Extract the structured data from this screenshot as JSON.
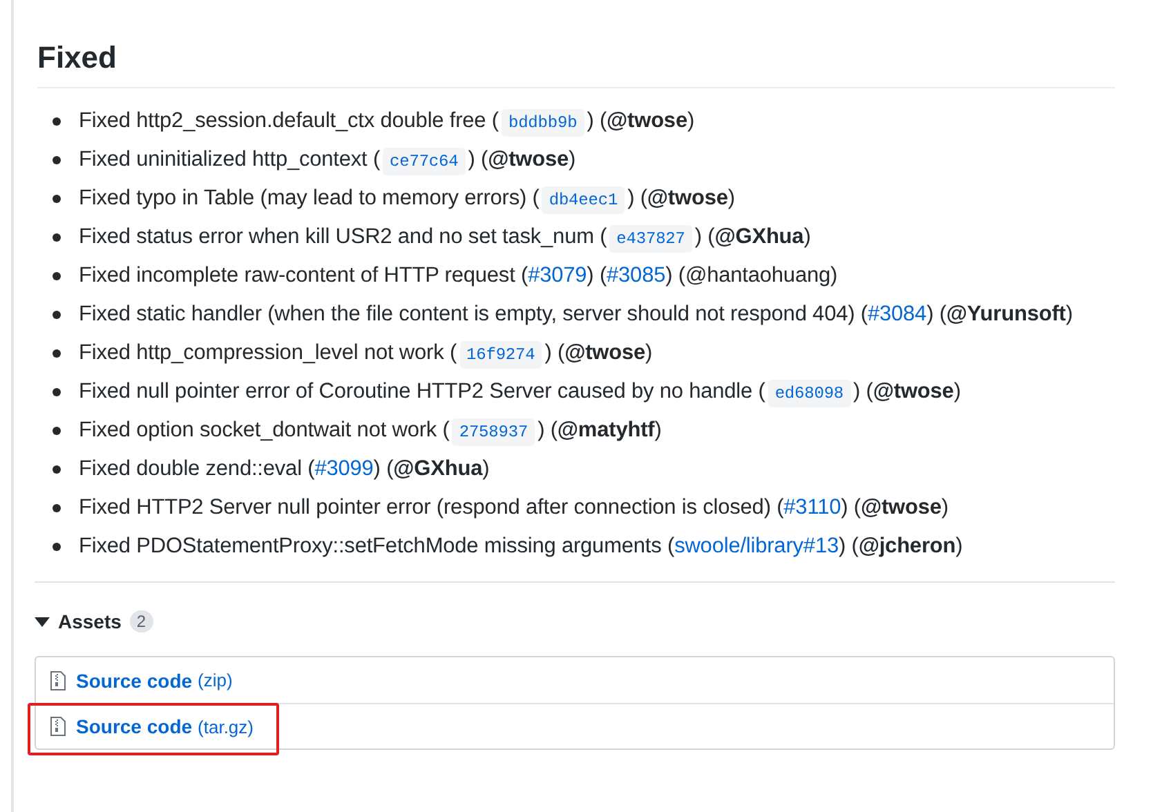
{
  "section": {
    "title": "Fixed",
    "items": [
      [
        {
          "kind": "text",
          "text": "Fixed http2_session.default_ctx double free ("
        },
        {
          "kind": "code",
          "text": "bddbb9b"
        },
        {
          "kind": "text",
          "text": ") (**@twose**)"
        }
      ],
      [
        {
          "kind": "text",
          "text": "Fixed uninitialized http_context ("
        },
        {
          "kind": "code",
          "text": "ce77c64"
        },
        {
          "kind": "text",
          "text": ") (**@twose**)"
        }
      ],
      [
        {
          "kind": "text",
          "text": "Fixed typo in Table (may lead to memory errors) ("
        },
        {
          "kind": "code",
          "text": "db4eec1"
        },
        {
          "kind": "text",
          "text": ") (**@twose**)"
        }
      ],
      [
        {
          "kind": "text",
          "text": "Fixed status error when kill USR2 and no set task_num ("
        },
        {
          "kind": "code",
          "text": "e437827"
        },
        {
          "kind": "text",
          "text": ") (**@GXhua**)"
        }
      ],
      [
        {
          "kind": "text",
          "text": "Fixed incomplete raw-content of HTTP request ("
        },
        {
          "kind": "link",
          "text": "#3079"
        },
        {
          "kind": "text",
          "text": ") ("
        },
        {
          "kind": "link",
          "text": "#3085"
        },
        {
          "kind": "text",
          "text": ") (@hantaohuang)"
        }
      ],
      [
        {
          "kind": "text",
          "text": "Fixed static handler (when the file content is empty, server should not respond 404) ("
        },
        {
          "kind": "link",
          "text": "#3084"
        },
        {
          "kind": "text",
          "text": ") (**@Yurunsoft**)"
        }
      ],
      [
        {
          "kind": "text",
          "text": "Fixed http_compression_level not work ("
        },
        {
          "kind": "code",
          "text": "16f9274"
        },
        {
          "kind": "text",
          "text": ") (**@twose**)"
        }
      ],
      [
        {
          "kind": "text",
          "text": "Fixed null pointer error of Coroutine HTTP2 Server caused by no handle ("
        },
        {
          "kind": "code",
          "text": "ed68098"
        },
        {
          "kind": "text",
          "text": ") (**@twose**)"
        }
      ],
      [
        {
          "kind": "text",
          "text": "Fixed option socket_dontwait not work ("
        },
        {
          "kind": "code",
          "text": "2758937"
        },
        {
          "kind": "text",
          "text": ") (**@matyhtf**)"
        }
      ],
      [
        {
          "kind": "text",
          "text": "Fixed double zend::eval ("
        },
        {
          "kind": "link",
          "text": "#3099"
        },
        {
          "kind": "text",
          "text": ") (**@GXhua**)"
        }
      ],
      [
        {
          "kind": "text",
          "text": "Fixed HTTP2 Server null pointer error (respond after connection is closed) ("
        },
        {
          "kind": "link",
          "text": "#3110"
        },
        {
          "kind": "text",
          "text": ") (**@twose**)"
        }
      ],
      [
        {
          "kind": "text",
          "text": "Fixed PDOStatementProxy::setFetchMode missing arguments ("
        },
        {
          "kind": "link",
          "text": "swoole/library#13"
        },
        {
          "kind": "text",
          "text": ") (**@jcheron**)"
        }
      ]
    ]
  },
  "assets": {
    "title": "Assets",
    "count": "2",
    "expanded": true,
    "items": [
      {
        "name": "Source code",
        "format": "(zip)",
        "highlighted": false
      },
      {
        "name": "Source code",
        "format": "(tar.gz)",
        "highlighted": true
      }
    ]
  }
}
